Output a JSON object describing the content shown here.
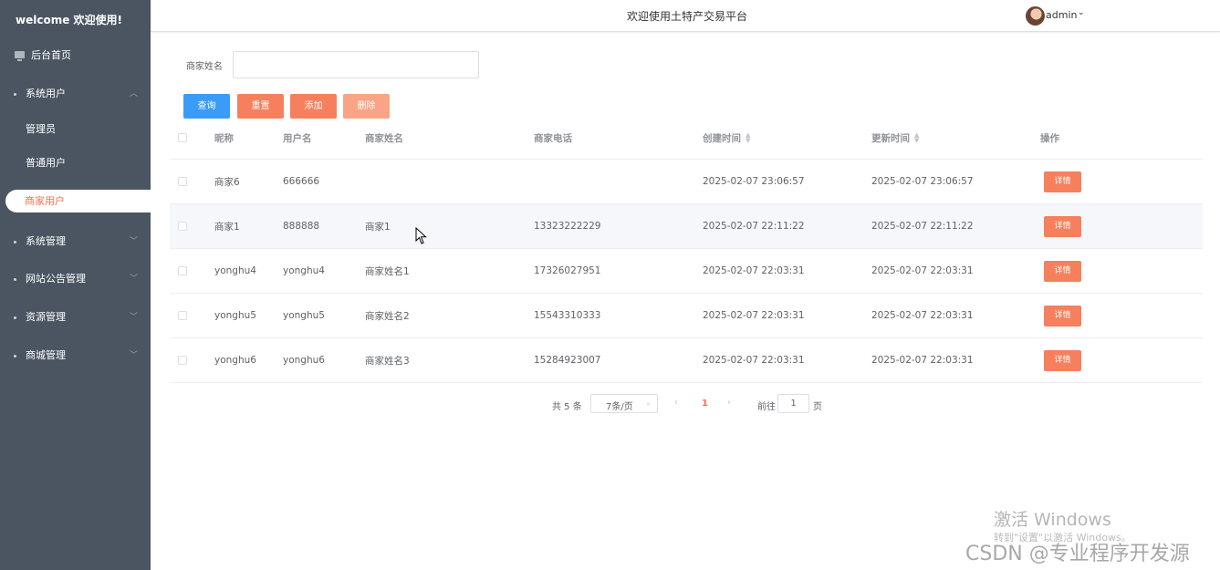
{
  "sidebar": {
    "title": "welcome 欢迎使用!",
    "home": "后台首页",
    "system_users": "系统用户",
    "admin": "管理员",
    "normal_users": "普通用户",
    "merchant_users": "商家用户",
    "system_mgmt": "系统管理",
    "notice_mgmt": "网站公告管理",
    "resource_mgmt": "资源管理",
    "mall_mgmt": "商城管理"
  },
  "header": {
    "title": "欢迎使用土特产交易平台",
    "user": "admin"
  },
  "search": {
    "label": "商家姓名",
    "value": ""
  },
  "buttons": {
    "query": "查询",
    "reset": "重置",
    "add": "添加",
    "delete": "删除"
  },
  "table": {
    "headers": {
      "nickname": "昵称",
      "username": "用户名",
      "merchant_name": "商家姓名",
      "phone": "商家电话",
      "created": "创建时间",
      "updated": "更新时间",
      "actions": "操作"
    },
    "detail_label": "详情",
    "rows": [
      {
        "nickname": "商家6",
        "username": "666666",
        "merchant_name": "",
        "phone": "",
        "created": "2025-02-07 23:06:57",
        "updated": "2025-02-07 23:06:57"
      },
      {
        "nickname": "商家1",
        "username": "888888",
        "merchant_name": "商家1",
        "phone": "13323222229",
        "created": "2025-02-07 22:11:22",
        "updated": "2025-02-07 22:11:22"
      },
      {
        "nickname": "yonghu4",
        "username": "yonghu4",
        "merchant_name": "商家姓名1",
        "phone": "17326027951",
        "created": "2025-02-07 22:03:31",
        "updated": "2025-02-07 22:03:31"
      },
      {
        "nickname": "yonghu5",
        "username": "yonghu5",
        "merchant_name": "商家姓名2",
        "phone": "15543310333",
        "created": "2025-02-07 22:03:31",
        "updated": "2025-02-07 22:03:31"
      },
      {
        "nickname": "yonghu6",
        "username": "yonghu6",
        "merchant_name": "商家姓名3",
        "phone": "15284923007",
        "created": "2025-02-07 22:03:31",
        "updated": "2025-02-07 22:03:31"
      }
    ]
  },
  "pagination": {
    "total": "共 5 条",
    "page_size": "7条/页",
    "current": "1",
    "goto_label": "前往",
    "goto_value": "1",
    "page_suffix": "页"
  },
  "watermark": {
    "activate_title": "激活 Windows",
    "activate_sub": "转到\"设置\"以激活 Windows。",
    "csdn": "CSDN @专业程序开发源"
  },
  "colors": {
    "sidebar_bg": "#4a5561",
    "accent": "#f4714f",
    "primary": "#3a9cf7",
    "danger_light": "#f9a487"
  }
}
